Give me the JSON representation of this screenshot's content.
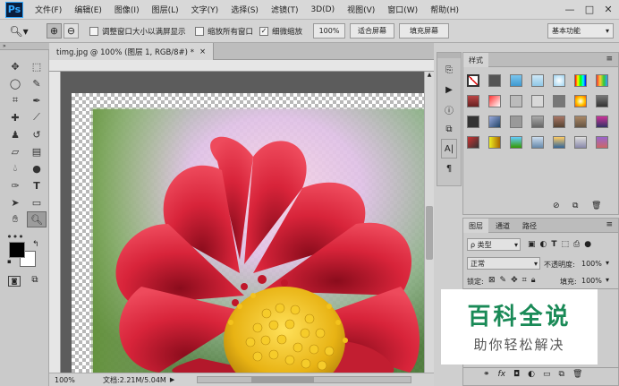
{
  "app": {
    "logo": "Ps"
  },
  "menu": [
    "文件(F)",
    "编辑(E)",
    "图像(I)",
    "图层(L)",
    "文字(Y)",
    "选择(S)",
    "滤镜(T)",
    "3D(D)",
    "视图(V)",
    "窗口(W)",
    "帮助(H)"
  ],
  "window_controls": {
    "minimize": "—",
    "maximize": "□",
    "close": "✕"
  },
  "options": {
    "resize_label": "调整窗口大小以满屏显示",
    "zoom_all_label": "缩放所有窗口",
    "scrubby_label": "细微缩放",
    "zoom_value": "100%",
    "fit_screen": "适合屏幕",
    "fill_screen": "填充屏幕",
    "workspace": "基本功能",
    "resize_checked": false,
    "zoom_all_checked": false,
    "scrubby_checked": true
  },
  "document": {
    "tab_title": "timg.jpg @ 100% (图层 1, RGB/8#) *",
    "tab_close": "×",
    "zoom": "100%",
    "doc_info": "文档:2.21M/5.04M"
  },
  "styles_panel": {
    "tab": "样式"
  },
  "layers_panel": {
    "tabs": [
      "图层",
      "通道",
      "路径"
    ],
    "filter_kind": "类型",
    "blend_mode": "正常",
    "opacity_label": "不透明度:",
    "opacity_value": "100%",
    "lock_label": "锁定:",
    "fill_label": "填充:",
    "fill_value": "100%"
  },
  "watermark": {
    "title": "百科全说",
    "subtitle": "助你轻松解决"
  },
  "colors": {
    "accent": "#31a8ff",
    "watermark_green": "#1a8a57"
  }
}
